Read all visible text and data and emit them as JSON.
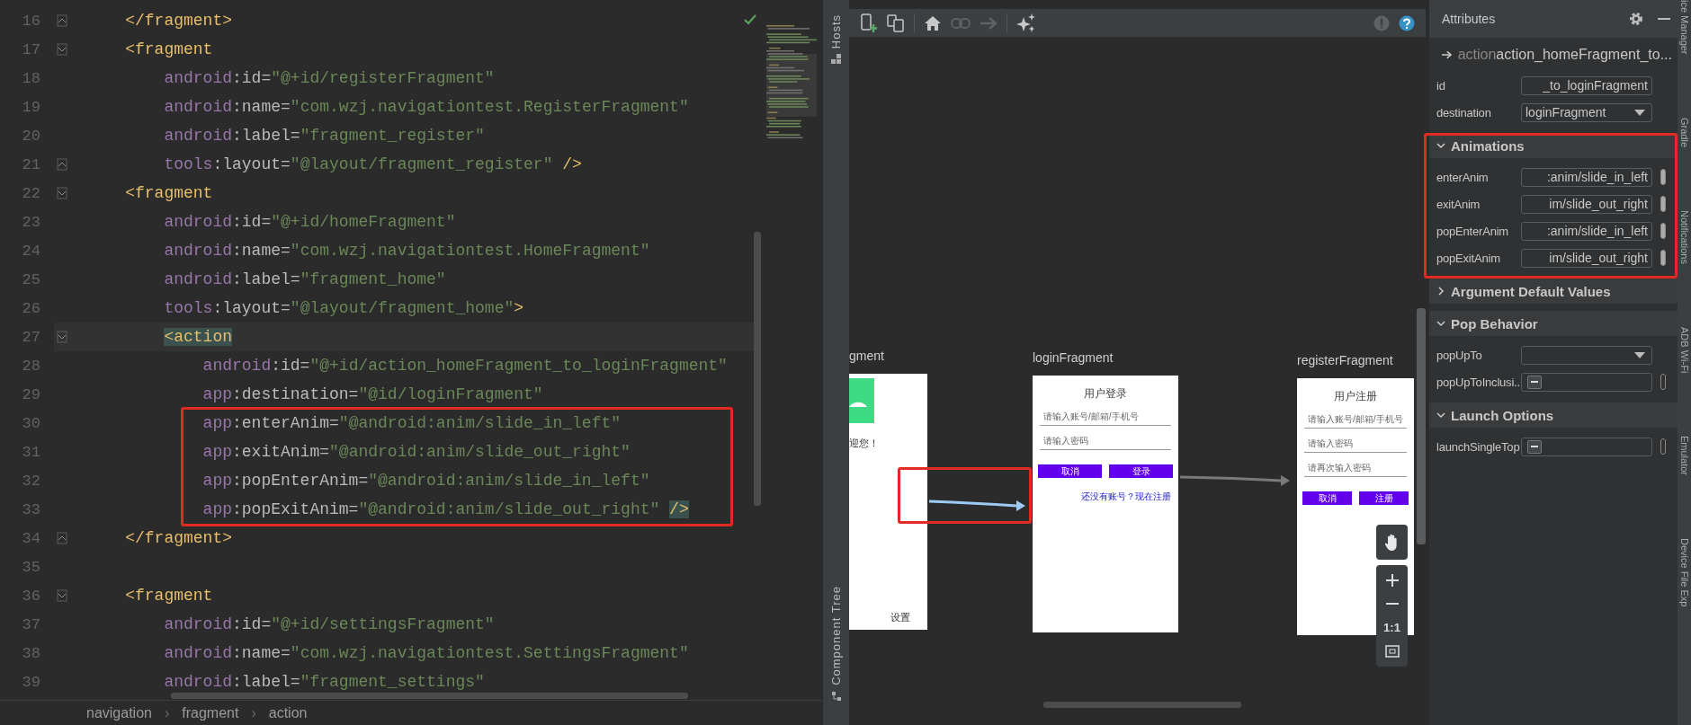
{
  "editor": {
    "lines": [
      {
        "number": "16",
        "fold_start": false,
        "fold_end": true,
        "current": false,
        "tokens": [
          {
            "kind": "tag",
            "text": "</fragment>"
          }
        ]
      },
      {
        "number": "17",
        "fold_start": true,
        "fold_end": false,
        "current": false,
        "tokens": [
          {
            "kind": "tag",
            "text": "<fragment"
          }
        ],
        "children": [
          {
            "number": "18",
            "fold_start": false,
            "fold_end": false,
            "current": false,
            "tokens": [
              {
                "kind": "ns",
                "text": "android"
              },
              {
                "kind": "attr",
                "text": ":id="
              },
              {
                "kind": "value",
                "text": "\"@+id/registerFragment\""
              }
            ]
          },
          {
            "number": "19",
            "fold_start": false,
            "fold_end": false,
            "current": false,
            "tokens": [
              {
                "kind": "ns",
                "text": "android"
              },
              {
                "kind": "attr",
                "text": ":name="
              },
              {
                "kind": "value",
                "text": "\"com.wzj.navigationtest.RegisterFragment\""
              }
            ]
          },
          {
            "number": "20",
            "fold_start": false,
            "fold_end": false,
            "current": false,
            "tokens": [
              {
                "kind": "ns",
                "text": "android"
              },
              {
                "kind": "attr",
                "text": ":label="
              },
              {
                "kind": "value",
                "text": "\"fragment_register\""
              }
            ]
          },
          {
            "number": "21",
            "fold_start": false,
            "fold_end": true,
            "current": false,
            "tokens": [
              {
                "kind": "ns",
                "text": "tools"
              },
              {
                "kind": "attr",
                "text": ":layout="
              },
              {
                "kind": "value",
                "text": "\"@layout/fragment_register\""
              },
              {
                "kind": "tag",
                "text": " />"
              }
            ]
          }
        ]
      },
      {
        "number": "22",
        "fold_start": true,
        "fold_end": false,
        "current": false,
        "tokens": [
          {
            "kind": "tag",
            "text": "<fragment"
          }
        ],
        "children": [
          {
            "number": "23",
            "fold_start": false,
            "fold_end": false,
            "current": false,
            "tokens": [
              {
                "kind": "ns",
                "text": "android"
              },
              {
                "kind": "attr",
                "text": ":id="
              },
              {
                "kind": "value",
                "text": "\"@+id/homeFragment\""
              }
            ]
          },
          {
            "number": "24",
            "fold_start": false,
            "fold_end": false,
            "current": false,
            "tokens": [
              {
                "kind": "ns",
                "text": "android"
              },
              {
                "kind": "attr",
                "text": ":name="
              },
              {
                "kind": "value",
                "text": "\"com.wzj.navigationtest.HomeFragment\""
              }
            ]
          },
          {
            "number": "25",
            "fold_start": false,
            "fold_end": false,
            "current": false,
            "tokens": [
              {
                "kind": "ns",
                "text": "android"
              },
              {
                "kind": "attr",
                "text": ":label="
              },
              {
                "kind": "value",
                "text": "\"fragment_home\""
              }
            ]
          },
          {
            "number": "26",
            "fold_start": false,
            "fold_end": false,
            "current": false,
            "tokens": [
              {
                "kind": "ns",
                "text": "tools"
              },
              {
                "kind": "attr",
                "text": ":layout="
              },
              {
                "kind": "value",
                "text": "\"@layout/fragment_home\""
              },
              {
                "kind": "tag",
                "text": ">"
              }
            ]
          },
          {
            "number": "27",
            "fold_start": true,
            "fold_end": false,
            "current": true,
            "tokens": [
              {
                "kind": "tag-match",
                "text": "<action"
              }
            ],
            "children": [
              {
                "number": "28",
                "fold_start": false,
                "fold_end": false,
                "current": false,
                "tokens": [
                  {
                    "kind": "ns",
                    "text": "android"
                  },
                  {
                    "kind": "attr",
                    "text": ":id="
                  },
                  {
                    "kind": "value",
                    "text": "\"@+id/action_homeFragment_to_loginFragment\""
                  }
                ]
              },
              {
                "number": "29",
                "fold_start": false,
                "fold_end": false,
                "current": false,
                "tokens": [
                  {
                    "kind": "ns",
                    "text": "app"
                  },
                  {
                    "kind": "attr",
                    "text": ":destination="
                  },
                  {
                    "kind": "value",
                    "text": "\"@id/loginFragment\""
                  }
                ]
              },
              {
                "number": "30",
                "fold_start": false,
                "fold_end": false,
                "current": false,
                "tokens": [
                  {
                    "kind": "ns",
                    "text": "app"
                  },
                  {
                    "kind": "attr",
                    "text": ":enterAnim="
                  },
                  {
                    "kind": "value",
                    "text": "\"@android:anim/slide_in_left\""
                  }
                ]
              },
              {
                "number": "31",
                "fold_start": false,
                "fold_end": false,
                "current": false,
                "tokens": [
                  {
                    "kind": "ns",
                    "text": "app"
                  },
                  {
                    "kind": "attr",
                    "text": ":exitAnim="
                  },
                  {
                    "kind": "value",
                    "text": "\"@android:anim/slide_out_right\""
                  }
                ]
              },
              {
                "number": "32",
                "fold_start": false,
                "fold_end": false,
                "current": false,
                "tokens": [
                  {
                    "kind": "ns",
                    "text": "app"
                  },
                  {
                    "kind": "attr",
                    "text": ":popEnterAnim="
                  },
                  {
                    "kind": "value",
                    "text": "\"@android:anim/slide_in_left\""
                  }
                ]
              },
              {
                "number": "33",
                "fold_start": false,
                "fold_end": false,
                "current": false,
                "tokens": [
                  {
                    "kind": "ns",
                    "text": "app"
                  },
                  {
                    "kind": "attr",
                    "text": ":popExitAnim="
                  },
                  {
                    "kind": "value",
                    "text": "\"@android:anim/slide_out_right\" "
                  },
                  {
                    "kind": "tag-match",
                    "text": "/>"
                  }
                ]
              }
            ]
          }
        ]
      },
      {
        "number": "34",
        "fold_start": false,
        "fold_end": true,
        "current": false,
        "tokens": [
          {
            "kind": "tag",
            "text": "</fragment>"
          }
        ]
      },
      {
        "number": "35",
        "fold_start": false,
        "fold_end": false,
        "current": false
      },
      {
        "number": "36",
        "fold_start": true,
        "fold_end": false,
        "current": false,
        "tokens": [
          {
            "kind": "tag",
            "text": "<fragment"
          }
        ],
        "children": [
          {
            "number": "37",
            "fold_start": false,
            "fold_end": false,
            "current": false,
            "tokens": [
              {
                "kind": "ns",
                "text": "android"
              },
              {
                "kind": "attr",
                "text": ":id="
              },
              {
                "kind": "value",
                "text": "\"@+id/settingsFragment\""
              }
            ]
          },
          {
            "number": "38",
            "fold_start": false,
            "fold_end": false,
            "current": false,
            "tokens": [
              {
                "kind": "ns",
                "text": "android"
              },
              {
                "kind": "attr",
                "text": ":name="
              },
              {
                "kind": "value",
                "text": "\"com.wzj.navigationtest.SettingsFragment\""
              }
            ]
          },
          {
            "number": "39",
            "fold_start": false,
            "fold_end": false,
            "current": false,
            "tokens": [
              {
                "kind": "ns",
                "text": "android"
              },
              {
                "kind": "attr",
                "text": ":label="
              },
              {
                "kind": "value",
                "text": "\"fragment_settings\""
              }
            ]
          }
        ]
      }
    ],
    "breadcrumbs": [
      {
        "kind": "crumb",
        "text": "navigation"
      },
      {
        "kind": "separator",
        "text": "›"
      },
      {
        "kind": "crumb",
        "text": "fragment"
      },
      {
        "kind": "separator",
        "text": "›"
      },
      {
        "kind": "crumb",
        "text": "action"
      }
    ]
  },
  "hosts_strip": {
    "top_label": "Hosts",
    "bottom_label": "Component Tree"
  },
  "toolbar": {
    "buttons": [
      {
        "kind": "new-destination",
        "disabled": false
      },
      {
        "kind": "nested-graph",
        "disabled": false
      },
      {
        "kind": "separator"
      },
      {
        "kind": "home",
        "disabled": false
      },
      {
        "kind": "link",
        "disabled": true
      },
      {
        "kind": "arrow",
        "disabled": true
      },
      {
        "kind": "separator"
      },
      {
        "kind": "auto-arrange",
        "disabled": false
      },
      {
        "kind": "spacer"
      },
      {
        "kind": "warning",
        "disabled": true
      },
      {
        "kind": "help",
        "disabled": false
      }
    ]
  },
  "canvas": {
    "home_destination": {
      "label": "gment",
      "greeting": "迎您！",
      "settings_text": "设置"
    },
    "login_destination": {
      "label": "loginFragment",
      "title": "用户登录",
      "fields": [
        {
          "placeholder": "请输入账号/邮箱/手机号"
        },
        {
          "placeholder": "请输入密码"
        }
      ],
      "buttons": [
        "取消",
        "登录"
      ],
      "link": "还没有账号？现在注册"
    },
    "register_destination": {
      "label": "registerFragment",
      "title": "用户注册",
      "fields": [
        {
          "placeholder": "请输入账号/邮箱/手机号"
        },
        {
          "placeholder": "请输入密码"
        },
        {
          "placeholder": "请再次输入密码"
        }
      ],
      "buttons": [
        "取消",
        "注册"
      ]
    },
    "actions": [
      {
        "kind": "home-login",
        "selected": true
      },
      {
        "kind": "login-register",
        "selected": false
      }
    ],
    "zoom_controls": {
      "actual_size_label": "1:1"
    }
  },
  "attributes": {
    "title": "Attributes",
    "element_type": "action",
    "element_name": "action_homeFragment_to...",
    "fields": [
      {
        "label": "id",
        "kind": "text",
        "value": "_to_loginFragment"
      },
      {
        "label": "destination",
        "kind": "dropdown",
        "value": "loginFragment"
      }
    ],
    "sections": [
      {
        "title": "Animations",
        "expanded": true,
        "fields": [
          {
            "label": "enterAnim",
            "kind": "resource",
            "value": ":anim/slide_in_left"
          },
          {
            "label": "exitAnim",
            "kind": "resource",
            "value": "im/slide_out_right"
          },
          {
            "label": "popEnterAnim",
            "kind": "resource",
            "value": ":anim/slide_in_left"
          },
          {
            "label": "popExitAnim",
            "kind": "resource",
            "value": "im/slide_out_right"
          }
        ]
      },
      {
        "title": "Argument Default Values",
        "expanded": false
      },
      {
        "title": "Pop Behavior",
        "expanded": true,
        "fields": [
          {
            "label": "popUpTo",
            "kind": "dropdown"
          },
          {
            "label": "popUpToInclusi..",
            "kind": "checkbox",
            "indeterminate": true
          }
        ]
      },
      {
        "title": "Launch Options",
        "expanded": true,
        "fields": [
          {
            "label": "launchSingleTop",
            "kind": "checkbox",
            "indeterminate": true
          }
        ]
      }
    ]
  },
  "right_strip": {
    "labels": [
      "ice Manager",
      "Gradle",
      "Notifications",
      "ADB Wi-Fi",
      "Emulator",
      "Device File Exp"
    ]
  }
}
